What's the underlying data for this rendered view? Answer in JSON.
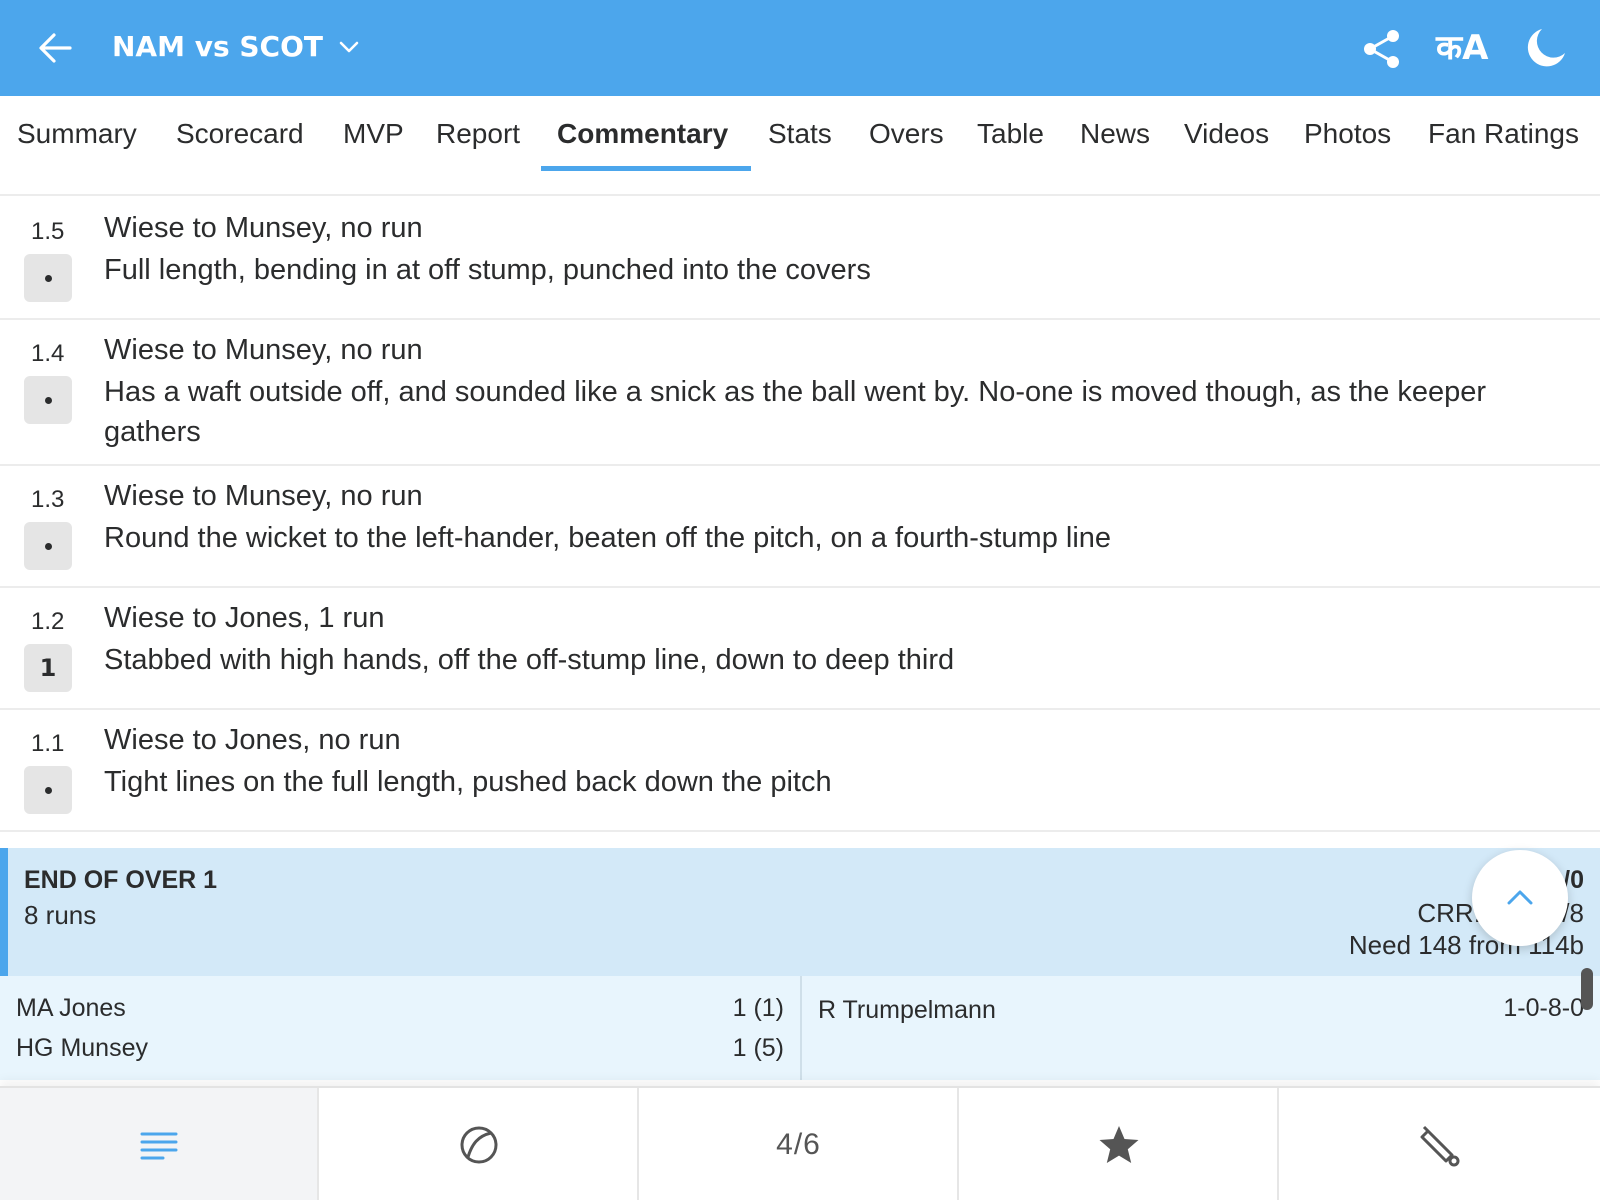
{
  "header": {
    "match_title": "NAM vs SCOT",
    "lang_label": "कA",
    "icons": [
      "back-arrow-icon",
      "chevron-down-icon",
      "share-icon",
      "language-icon",
      "moon-icon"
    ],
    "accent_color": "#4ca6ec"
  },
  "tabs": [
    {
      "label": "Summary",
      "active": false
    },
    {
      "label": "Scorecard",
      "active": false
    },
    {
      "label": "MVP",
      "active": false
    },
    {
      "label": "Report",
      "active": false
    },
    {
      "label": "Commentary",
      "active": true
    },
    {
      "label": "Stats",
      "active": false
    },
    {
      "label": "Overs",
      "active": false
    },
    {
      "label": "Table",
      "active": false
    },
    {
      "label": "News",
      "active": false
    },
    {
      "label": "Videos",
      "active": false
    },
    {
      "label": "Photos",
      "active": false
    },
    {
      "label": "Fan Ratings",
      "active": false
    }
  ],
  "commentary": [
    {
      "over": "1.5",
      "result": "•",
      "headline": "Wiese to Munsey, no run",
      "text": "Full length, bending in at off stump, punched into the covers"
    },
    {
      "over": "1.4",
      "result": "•",
      "headline": "Wiese to Munsey, no run",
      "text": "Has a waft outside off, and sounded like a snick as the ball went by. No-one is moved though, as the keeper gathers"
    },
    {
      "over": "1.3",
      "result": "•",
      "headline": "Wiese to Munsey, no run",
      "text": "Round the wicket to the left-hander, beaten off the pitch, on a fourth-stump line"
    },
    {
      "over": "1.2",
      "result": "1",
      "headline": "Wiese to Jones, 1 run",
      "text": "Stabbed with high hands, off the off-stump line, down to deep third"
    },
    {
      "over": "1.1",
      "result": "•",
      "headline": "Wiese to Jones, no run",
      "text": "Tight lines on the full length, pushed back down the pitch"
    }
  ],
  "over_summary": {
    "title": "END OF OVER 1",
    "runs": "8 runs",
    "score": "SC    /0",
    "crr": "CRR: 8.00 •      /8",
    "need": "Need 148 from 114b"
  },
  "batters": [
    {
      "name": "MA Jones",
      "score": "1 (1)"
    },
    {
      "name": "HG Munsey",
      "score": "1 (5)"
    }
  ],
  "bowler": {
    "name": "R Trumpelmann",
    "figures": "1-0-8-0"
  },
  "bottom_nav": {
    "items": [
      "menu-lines-icon",
      "ball-icon",
      "page-counter",
      "star-icon",
      "bat-icon"
    ],
    "page_counter": "4/6"
  }
}
